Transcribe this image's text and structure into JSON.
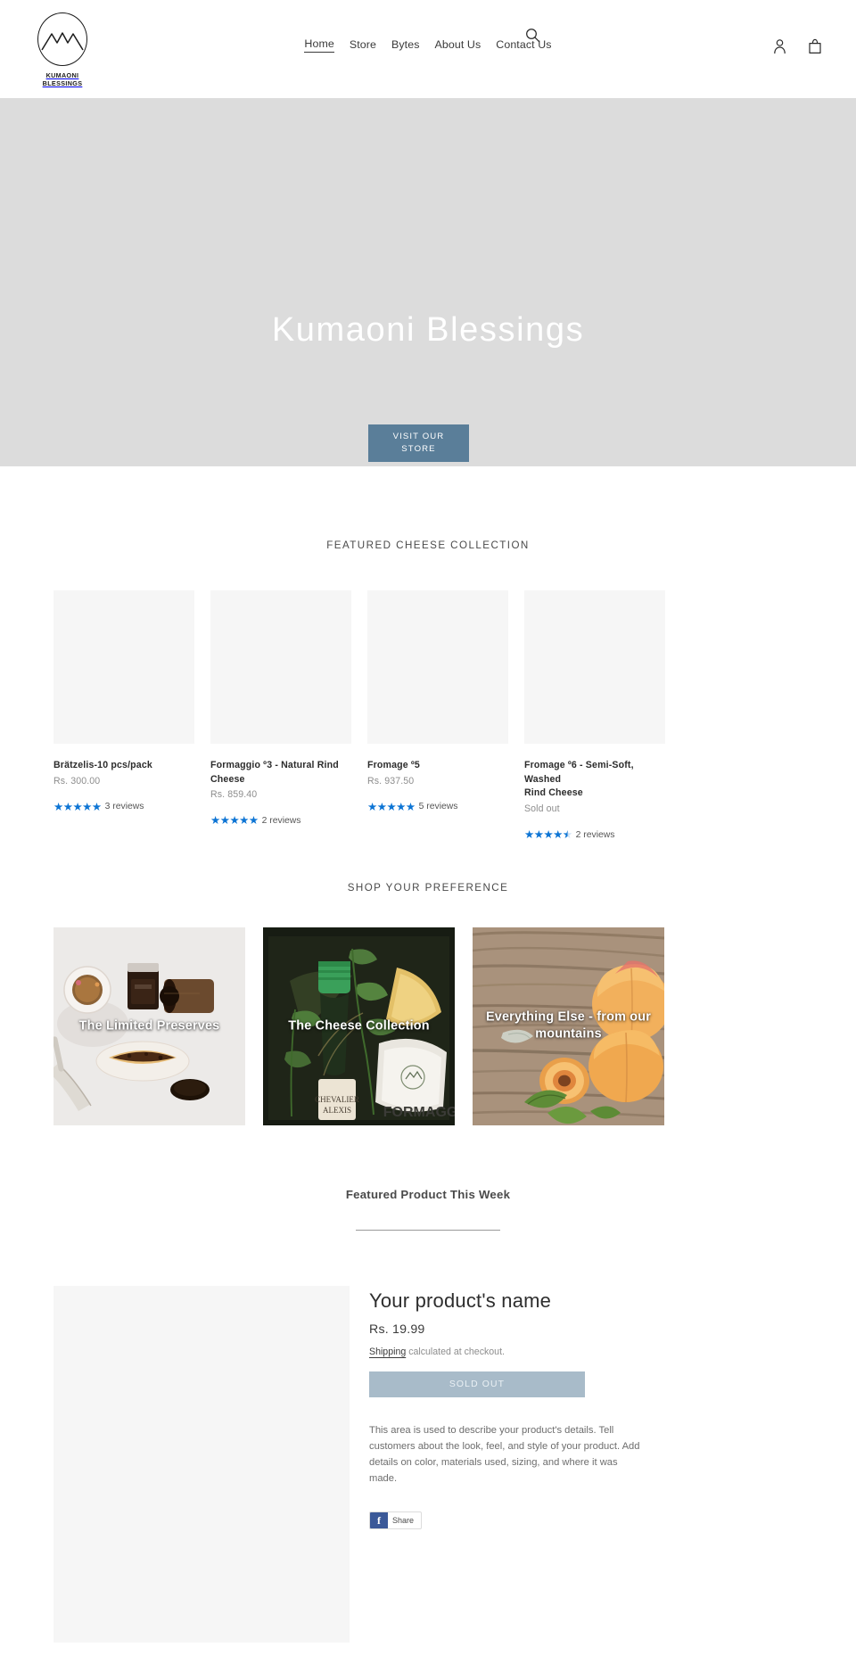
{
  "header": {
    "logo": {
      "icon": "mountain-logo-icon",
      "line1": "KUMAONI",
      "line2": "BLESSINGS"
    },
    "nav": [
      {
        "label": "Home",
        "active": true
      },
      {
        "label": "Store",
        "active": false
      },
      {
        "label": "Bytes",
        "active": false
      },
      {
        "label": "About Us",
        "active": false
      },
      {
        "label": "Contact Us",
        "active": false
      }
    ],
    "search_icon": "search-icon",
    "account_icon": "account-icon",
    "cart_icon": "cart-icon"
  },
  "hero": {
    "title": "Kumaoni Blessings",
    "cta_label": "VISIT OUR STORE",
    "cta_color": "#5a7e99",
    "background_color": "#dcdcdc"
  },
  "featured_collection": {
    "heading": "FEATURED CHEESE COLLECTION",
    "products": [
      {
        "title": "Brätzelis-10 pcs/pack",
        "price": "Rs. 300.00",
        "rating": 5,
        "reviews": "3 reviews"
      },
      {
        "title": "Formaggio º3 - Natural Rind\nCheese",
        "price": "Rs. 859.40",
        "rating": 5,
        "reviews": "2 reviews"
      },
      {
        "title": "Fromage º5",
        "price": "Rs. 937.50",
        "rating": 5,
        "reviews": "5 reviews"
      },
      {
        "title": "Fromage º6 - Semi-Soft, Washed\nRind Cheese",
        "price": "Sold out",
        "rating": 4.5,
        "reviews": "2 reviews"
      }
    ]
  },
  "shop_preference": {
    "heading": "SHOP YOUR PREFERENCE",
    "collections": [
      {
        "label": "The Limited Preserves",
        "scene": "preserves-photo"
      },
      {
        "label": "The Cheese Collection",
        "scene": "cheese-gift-box-photo"
      },
      {
        "label": "Everything Else - from our\nmountains",
        "scene": "apricots-photo"
      }
    ]
  },
  "featured_product": {
    "heading": "Featured Product This Week",
    "name": "Your product's name",
    "price": "Rs. 19.99",
    "shipping_link": "Shipping",
    "shipping_text": "calculated at checkout.",
    "sold_out_label": "SOLD OUT",
    "sold_out_color": "#a8bbc9",
    "description": "This area is used to describe your product's details. Tell customers about the look, feel, and style of your product. Add details on color, materials used, sizing, and where it was made.",
    "share_label": "Share"
  },
  "accent_colors": {
    "star": "#0c74d4",
    "button": "#5a7e99",
    "hero_bg": "#dcdcdc",
    "image_placeholder": "#f6f6f6"
  }
}
